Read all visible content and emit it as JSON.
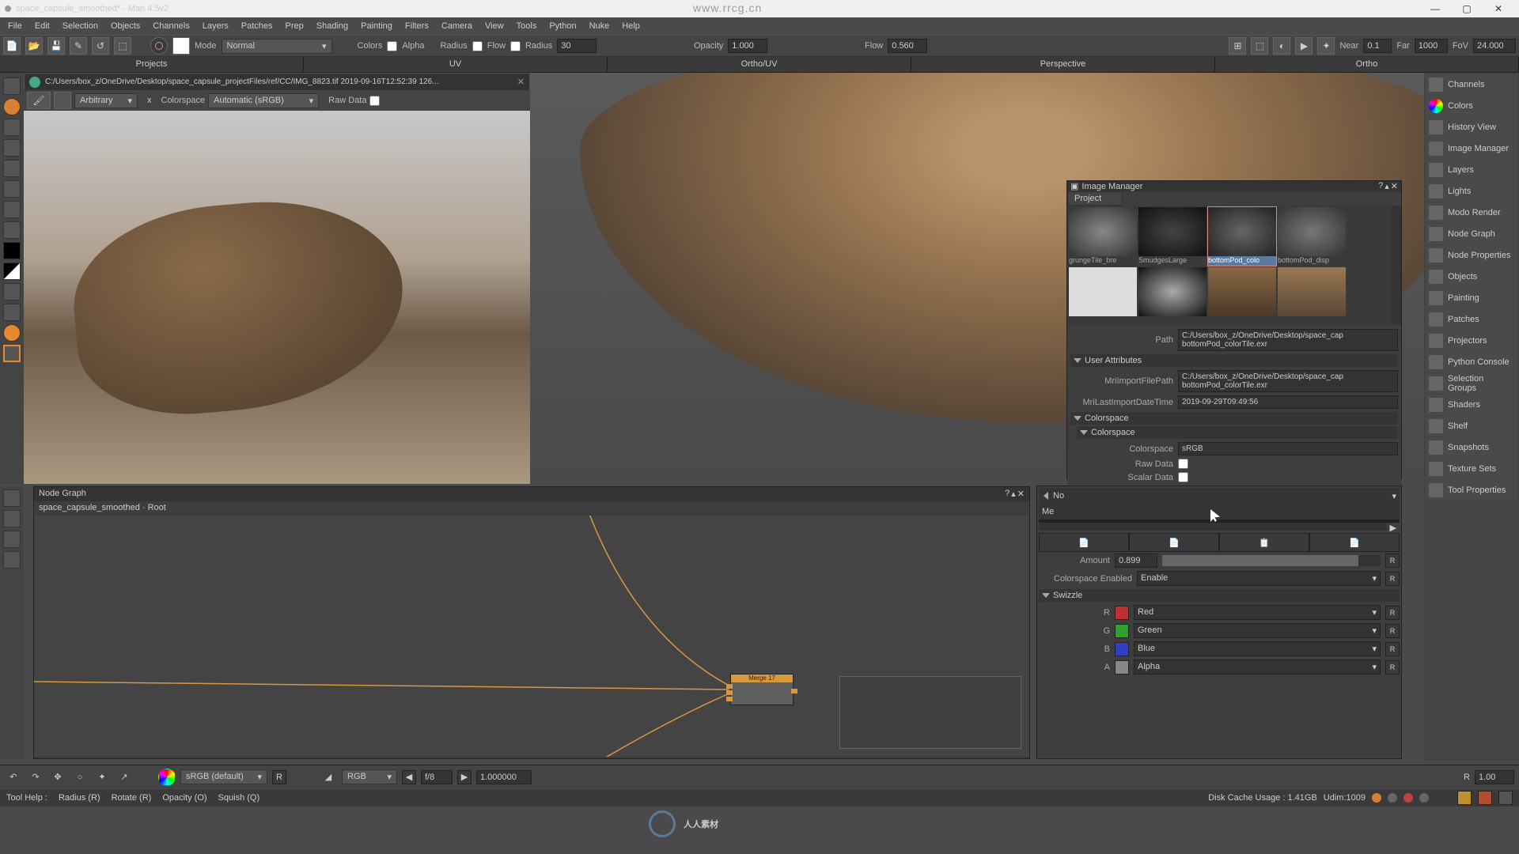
{
  "title": "space_capsule_smoothed* - Mari 4.5v2",
  "watermark_url": "www.rrcg.cn",
  "window_buttons": {
    "min": "—",
    "max": "▢",
    "close": "✕"
  },
  "menus": [
    "File",
    "Edit",
    "Selection",
    "Objects",
    "Channels",
    "Layers",
    "Patches",
    "Prep",
    "Shading",
    "Painting",
    "Filters",
    "Camera",
    "View",
    "Tools",
    "Python",
    "Nuke",
    "Help"
  ],
  "toolbar": {
    "mode_label": "Mode",
    "mode_value": "Normal",
    "colors_label": "Colors",
    "alpha_label": "Alpha",
    "radius_chk_label": "Radius",
    "flow_label": "Flow",
    "radius_label": "Radius",
    "radius_value": "30",
    "opacity_label": "Opacity",
    "opacity_value": "1.000",
    "flow2_label": "Flow",
    "flow_value": "0.560",
    "near_label": "Near",
    "near_value": "0.1",
    "far_label": "Far",
    "far_value": "1000",
    "fov_label": "FoV",
    "fov_value": "24.000"
  },
  "view_tabs": [
    "Projects",
    "UV",
    "Ortho/UV",
    "Perspective",
    "Ortho"
  ],
  "ref_tab": {
    "path": "C:/Users/box_z/OneDrive/Desktop/space_capsule_projectFiles/ref/CC/IMG_8823.tif 2019-09-16T12:52:39 126...",
    "arb_label": "Arbitrary",
    "x_label": "x",
    "cs_label": "Colorspace",
    "cs_value": "Automatic (sRGB)",
    "raw_label": "Raw Data"
  },
  "image_manager": {
    "title": "Image Manager",
    "tab": "Project",
    "thumbs": [
      {
        "label": "grungeTile_bre"
      },
      {
        "label": "SmudgesLarge"
      },
      {
        "label": "bottomPod_colo"
      },
      {
        "label": "bottomPod_disp"
      },
      {
        "label": ""
      },
      {
        "label": ""
      },
      {
        "label": ""
      },
      {
        "label": ""
      }
    ],
    "path_label": "Path",
    "path_value": "C:/Users/box_z/OneDrive/Desktop/space_cap\nbottomPod_colorTile.exr",
    "user_attrs": "User Attributes",
    "import_path_label": "MriImportFilePath",
    "import_path_value": "C:/Users/box_z/OneDrive/Desktop/space_cap\nbottomPod_colorTile.exr",
    "import_date_label": "MriLastImportDateTime",
    "import_date_value": "2019-09-29T09:49:56",
    "colorspace_hdr": "Colorspace",
    "colorspace_sub": "Colorspace",
    "cs_label": "Colorspace",
    "cs_value": "sRGB",
    "raw_label": "Raw Data",
    "scalar_label": "Scalar Data"
  },
  "node_graph": {
    "title": "Node Graph",
    "root": "space_capsule_smoothed · Root",
    "node1_label": "Merge 17"
  },
  "right_props": {
    "header1": "No",
    "header2": "Me",
    "btn_icons": [
      "📄",
      "📄",
      "📋",
      "📄"
    ],
    "amount_label": "Amount",
    "amount_value": "0.899",
    "cse_label": "Colorspace Enabled",
    "cse_value": "Enable",
    "swizzle": "Swizzle",
    "r_label": "R",
    "r_value": "Red",
    "g_label": "G",
    "g_value": "Green",
    "b_label": "B",
    "b_value": "Blue",
    "a_label": "A",
    "a_value": "Alpha",
    "reset": "R"
  },
  "bottom_bar": {
    "srgb": "sRGB (default)",
    "r": "R",
    "rgb": "RGB",
    "fstop": "f/8",
    "val": "1.000000",
    "r2_label": "R",
    "r2_value": "1.00"
  },
  "status": {
    "tool_help": "Tool Help :",
    "radius_r": "Radius (R)",
    "rotate_r": "Rotate (R)",
    "opacity_o": "Opacity (O)",
    "squish_q": "Squish (Q)",
    "disk": "Disk Cache Usage : 1.41GB",
    "udim": "Udim:1009"
  },
  "right_sidebar": [
    "Channels",
    "Colors",
    "History View",
    "Image Manager",
    "Layers",
    "Lights",
    "Modo Render",
    "Node Graph",
    "Node Properties",
    "Objects",
    "Painting",
    "Patches",
    "Projectors",
    "Python Console",
    "Selection Groups",
    "Shaders",
    "Shelf",
    "Snapshots",
    "Texture Sets",
    "Tool Properties"
  ],
  "footer_brand": "人人素材"
}
